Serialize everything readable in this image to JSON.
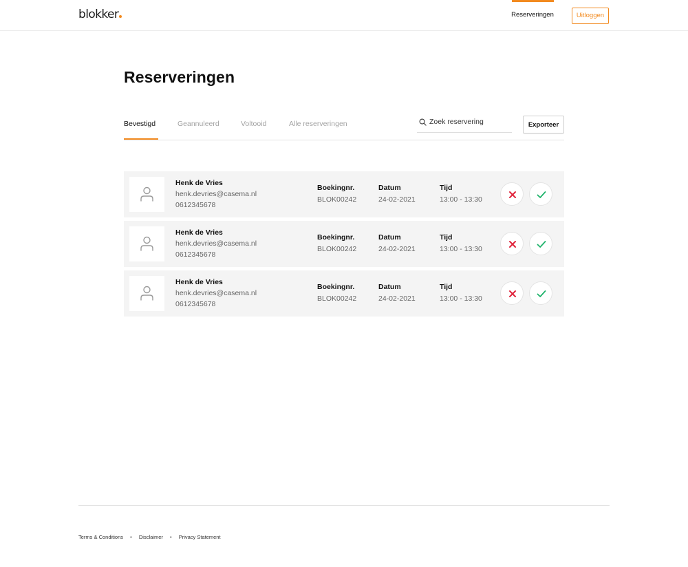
{
  "theme": {
    "accent": "#f28a1f",
    "reject": "#e0243c",
    "accept": "#1fb36b"
  },
  "header": {
    "logo_text": "blokker",
    "nav_link": "Reserveringen",
    "logout_label": "Uitloggen"
  },
  "page": {
    "title": "Reserveringen"
  },
  "tabs": [
    {
      "label": "Bevestigd",
      "active": true
    },
    {
      "label": "Geannuleerd",
      "active": false
    },
    {
      "label": "Voltooid",
      "active": false
    },
    {
      "label": "Alle reserveringen",
      "active": false
    }
  ],
  "search": {
    "placeholder": "Zoek reservering",
    "value": ""
  },
  "export_label": "Exporteer",
  "columns": {
    "booking": "Boekingnr.",
    "date": "Datum",
    "time": "Tijd"
  },
  "reservations": [
    {
      "name": "Henk de Vries",
      "email": "henk.devries@casema.nl",
      "phone": "0612345678",
      "booking": "BLOK00242",
      "date": "24-02-2021",
      "time": "13:00 - 13:30"
    },
    {
      "name": "Henk de Vries",
      "email": "henk.devries@casema.nl",
      "phone": "0612345678",
      "booking": "BLOK00242",
      "date": "24-02-2021",
      "time": "13:00 - 13:30"
    },
    {
      "name": "Henk de Vries",
      "email": "henk.devries@casema.nl",
      "phone": "0612345678",
      "booking": "BLOK00242",
      "date": "24-02-2021",
      "time": "13:00 - 13:30"
    }
  ],
  "icons": {
    "avatar": "user-icon",
    "reject": "close-icon",
    "accept": "check-icon",
    "search": "search-icon"
  },
  "footer": {
    "links": [
      {
        "label": "Terms & Conditions"
      },
      {
        "label": "Disclaimer"
      },
      {
        "label": "Privacy Statement"
      }
    ],
    "separator": "•"
  }
}
